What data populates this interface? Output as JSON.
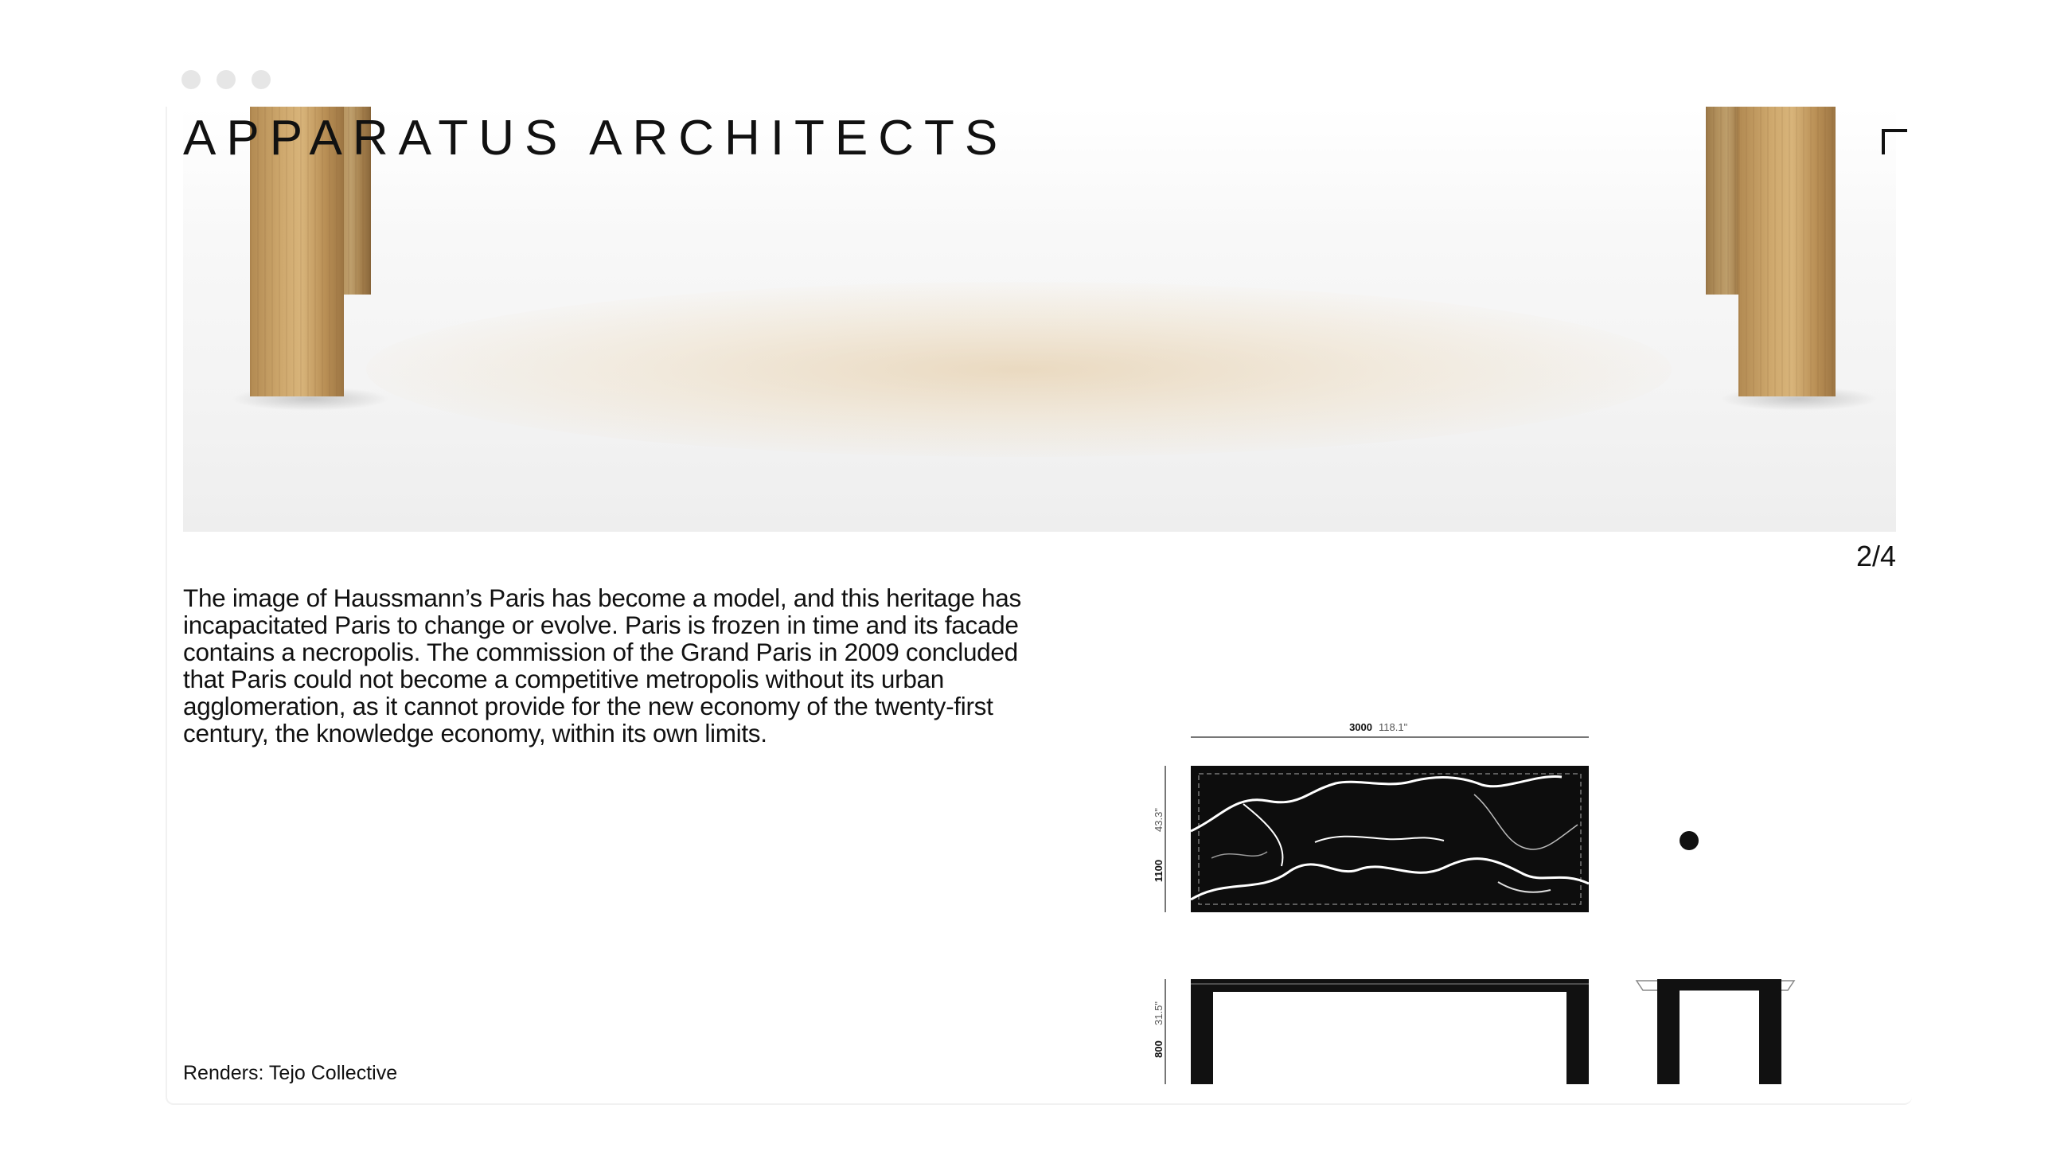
{
  "window": {
    "controls": [
      "window-dot",
      "window-dot",
      "window-dot"
    ]
  },
  "header": {
    "brand": "APPARATUS ARCHITECTS",
    "menu_icon": "plus-icon"
  },
  "hero": {
    "image": "table-render-wood-legs"
  },
  "gallery": {
    "counter": "2/4"
  },
  "project": {
    "description": "The image of Haussmann’s Paris has become a model, and this heritage has incapacitated Paris to change or evolve. Paris is frozen in time and its facade contains a necropolis. The commission of the Grand Paris in 2009 concluded that Paris could not become a competitive metropolis without its urban agglomeration, as it cannot provide for the new economy of the twenty-first century, the knowledge economy, within its own limits.",
    "credit": "Renders: Tejo Collective"
  },
  "drawing": {
    "width_mm": "3000",
    "width_in": "118.1\"",
    "depth_mm": "1100",
    "depth_in": "43.3\"",
    "height_mm": "800",
    "height_in": "31.5\""
  }
}
